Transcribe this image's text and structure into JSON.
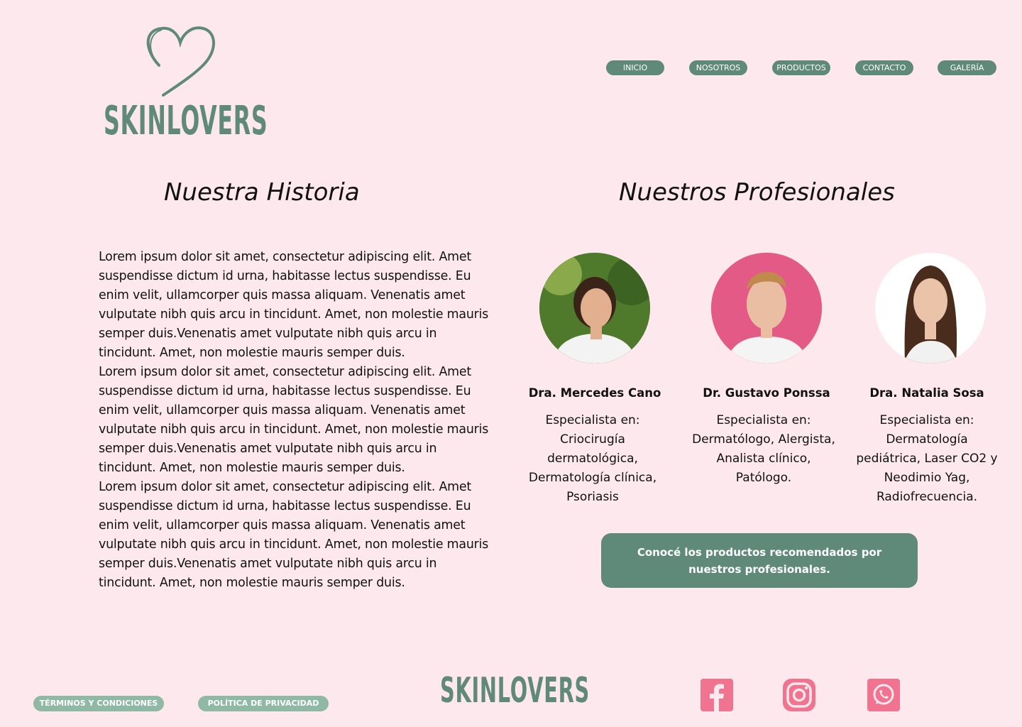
{
  "brand": {
    "name": "SKINLOVERS",
    "color": "#5f8a7a"
  },
  "nav": {
    "items": [
      "INICIO",
      "NOSOTROS",
      "PRODUCTOS",
      "CONTACTO",
      "GALERÍA"
    ]
  },
  "story": {
    "title": "Nuestra Historia",
    "paragraphs": [
      "Lorem ipsum dolor sit amet, consectetur adipiscing elit. Amet suspendisse dictum id urna, habitasse lectus suspendisse. Eu enim velit, ullamcorper quis massa aliquam. Venenatis amet vulputate nibh quis arcu in tincidunt. Amet, non molestie mauris semper duis.Venenatis amet vulputate nibh quis arcu in tincidunt. Amet, non molestie mauris semper duis.",
      "Lorem ipsum dolor sit amet, consectetur adipiscing elit. Amet suspendisse dictum id urna, habitasse lectus suspendisse. Eu enim velit, ullamcorper quis massa aliquam. Venenatis amet vulputate nibh quis arcu in tincidunt. Amet, non molestie mauris semper duis.Venenatis amet vulputate nibh quis arcu in tincidunt. Amet, non molestie mauris semper duis.",
      "Lorem ipsum dolor sit amet, consectetur adipiscing elit. Amet suspendisse dictum id urna, habitasse lectus suspendisse. Eu enim velit, ullamcorper quis massa aliquam. Venenatis amet vulputate nibh quis arcu in tincidunt. Amet, non molestie mauris semper duis.Venenatis amet vulputate nibh quis arcu in tincidunt. Amet, non molestie mauris semper duis."
    ]
  },
  "professionals": {
    "title": "Nuestros Profesionales",
    "list": [
      {
        "name": "Dra. Mercedes Cano",
        "specialty": "Especialista en: Criocirugía dermatológica, Dermatología clínica, Psoriasis",
        "photo_bg": "#4f7a2c"
      },
      {
        "name": "Dr. Gustavo Ponssa",
        "specialty": "Especialista en: Dermatólogo, Alergista, Analista clínico, Patólogo.",
        "photo_bg": "#e45a86"
      },
      {
        "name": "Dra. Natalia Sosa",
        "specialty": "Especialista en: Dermatología pediátrica, Laser CO2 y Neodimio Yag, Radiofrecuencia.",
        "photo_bg": "#ffffff"
      }
    ],
    "cta_label": "Conocé los productos recomendados por nuestros profesionales."
  },
  "footer": {
    "terms_label": "TÉRMINOS Y CONDICIONES",
    "privacy_label": "POLÍTICA DE PRIVACIDAD",
    "social_icons": [
      "facebook-icon",
      "instagram-icon",
      "whatsapp-icon"
    ],
    "social_color": "#f0748f"
  }
}
